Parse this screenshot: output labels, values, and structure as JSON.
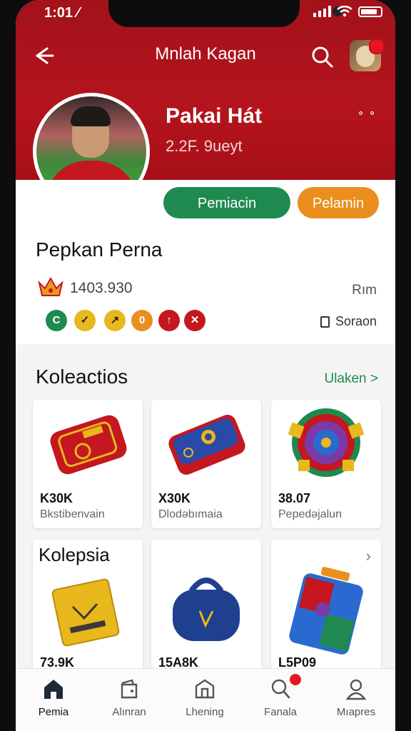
{
  "status": {
    "time": "1:01 ⁄"
  },
  "header": {
    "title": "Mnlah Kagan",
    "profile_name": "Pakai Hát",
    "profile_subtitle": "2.2F. 9ueyt",
    "more": "ᐤ ᐤ",
    "primary_button": "Pemiacin",
    "secondary_button": "Pelamin"
  },
  "profile": {
    "section_name": "Pepkan Perna",
    "score": "1403.930",
    "rank_label": "Rım",
    "sorting_label": "Soraon",
    "badges": [
      {
        "icon": "refresh-icon",
        "color": "#1f8a4f",
        "glyph": "C"
      },
      {
        "icon": "bird-icon",
        "color": "#e8b81c",
        "glyph": "✓"
      },
      {
        "icon": "flag-icon",
        "color": "#e8b81c",
        "glyph": "↗"
      },
      {
        "icon": "coin-icon",
        "color": "#ea8e1f",
        "glyph": "0"
      },
      {
        "icon": "tower-icon",
        "color": "#c4171f",
        "glyph": "↑"
      },
      {
        "icon": "swords-icon",
        "color": "#c4171f",
        "glyph": "✕"
      }
    ]
  },
  "collections": {
    "title": "Koleactios",
    "view_all": "Ulaken >",
    "items": [
      {
        "price": "K30K",
        "name": "Bkstibenvain"
      },
      {
        "price": "X30K",
        "name": "Dlodəbımaia"
      },
      {
        "price": "38.07",
        "name": "Pepedəjalun"
      }
    ]
  },
  "collections2": {
    "title": "Kolepsia",
    "chevron": "›",
    "items": [
      {
        "price": "73.9K"
      },
      {
        "price": "15A8K"
      },
      {
        "price": "L5P09"
      }
    ]
  },
  "nav": [
    {
      "label": "Pemia"
    },
    {
      "label": "Alınran"
    },
    {
      "label": "Lhening"
    },
    {
      "label": "Fanala"
    },
    {
      "label": "Mıapres"
    }
  ],
  "colors": {
    "brand_red": "#b4141d",
    "green": "#1f8a4f",
    "orange": "#ea8e1f"
  }
}
